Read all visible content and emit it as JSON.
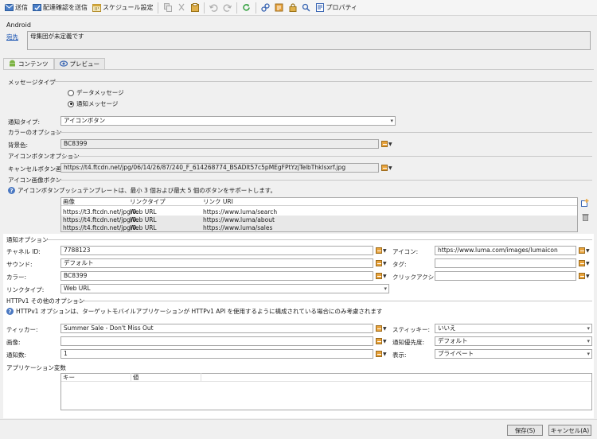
{
  "toolbar": {
    "send": "送信",
    "send_proof": "配達確認を送信",
    "schedule": "スケジュール設定",
    "properties": "プロパティ"
  },
  "android": {
    "title": "Android",
    "to_link": "宛先",
    "to_value": "母集団が未定義です"
  },
  "tabs": {
    "content": "コンテンツ",
    "preview": "プレビュー"
  },
  "message_type": {
    "heading": "メッセージタイプ",
    "data_message": "データメッセージ",
    "notification_message": "通知メッセージ"
  },
  "notification_type": {
    "label": "通知タイプ:",
    "value": "アイコンボタン"
  },
  "color_options": {
    "heading": "カラーのオプション",
    "bg_label": "背景色:",
    "bg_value": "BC8399"
  },
  "icon_button_options": {
    "heading": "アイコンボタンオプション",
    "cancel_image_label": "キャンセルボタン画像:",
    "cancel_image_value": "https://t4.ftcdn.net/jpg/06/14/26/87/240_F_614268774_BSADIt57c5pMEgFPtYzjTelbThklsxrf.jpg"
  },
  "icon_image_button": {
    "heading": "アイコン画像ボタン",
    "info": "アイコンボタンプッシュテンプレートは、最小 3 個および最大 5 個のボタンをサポートします。",
    "columns": [
      "画像",
      "リンクタイプ",
      "リンク URI"
    ],
    "rows": [
      [
        "https://t3.ftcdn.net/jpg/0.",
        "Web URL",
        "https://www.luma/search"
      ],
      [
        "https://t4.ftcdn.net/jpg/0.",
        "Web URL",
        "https://www.luma/about"
      ],
      [
        "https://t4.ftcdn.net/jpg/0.",
        "Web URL",
        "https://www.luma/sales"
      ]
    ]
  },
  "notification_options": {
    "heading": "通知オプション",
    "channel_id_label": "チャネル ID:",
    "channel_id_value": "7788123",
    "sound_label": "サウンド:",
    "sound_value": "デフォルト",
    "color_label": "カラー:",
    "color_value": "BC8399",
    "link_type_label": "リンクタイプ:",
    "link_type_value": "Web URL",
    "icon_label": "アイコン:",
    "icon_value": "https://www.luma.com/images/lumaicon",
    "tag_label": "タグ:",
    "tag_value": "",
    "click_action_label": "クリックアクション:",
    "click_action_value": ""
  },
  "httpv1": {
    "heading": "HTTPv1 その他のオプション",
    "info": "HTTPv1 オプションは、ターゲットモバイルアプリケーションが HTTPv1 API を使用するように構成されている場合にのみ考慮されます",
    "ticker_label": "ティッカー:",
    "ticker_value": "Summer Sale - Don't Miss Out",
    "image_label": "画像:",
    "image_value": "",
    "count_label": "通知数:",
    "count_value": "1",
    "sticky_label": "スティッキー:",
    "sticky_value": "いいえ",
    "priority_label": "通知優先度:",
    "priority_value": "デフォルト",
    "visibility_label": "表示:",
    "visibility_value": "プライベート"
  },
  "app_vars": {
    "heading": "アプリケーション変数",
    "columns": [
      "キー",
      "値"
    ]
  },
  "footer": {
    "save": "保存(S)",
    "cancel": "キャンセル(A)"
  }
}
